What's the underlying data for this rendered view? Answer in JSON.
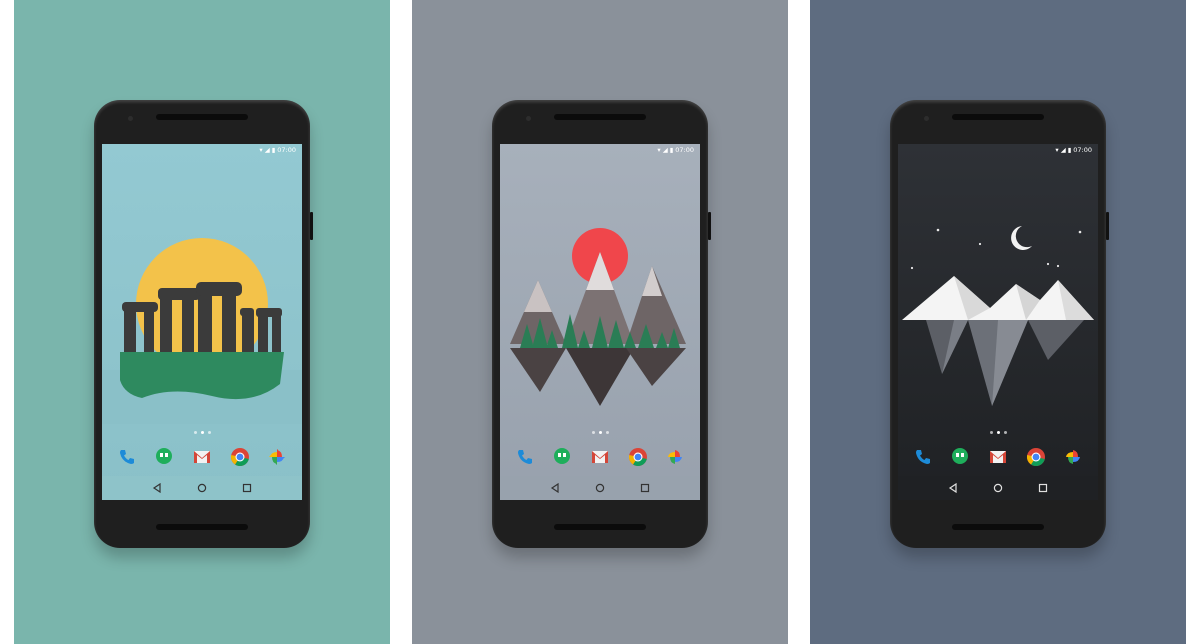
{
  "panels": [
    {
      "name": "stonehenge",
      "background": "#7ab5ac",
      "screen_top": "#93c9d2",
      "screen_bottom": "#8ac0c8",
      "nav_bg": "#8ec3c9"
    },
    {
      "name": "mountains",
      "background": "#8a919a",
      "screen_top": "#a7b0bb",
      "screen_bottom": "#98a1ad",
      "nav_bg": "#98a2ad"
    },
    {
      "name": "iceberg",
      "background": "#5e6c80",
      "screen_top": "#2e3136",
      "screen_bottom": "#1f2124",
      "nav_bg": "#1f2124"
    }
  ],
  "status_bar": {
    "time": "07:00"
  },
  "home_dots": {
    "count": 3,
    "active_index": 1
  },
  "dock_icons": [
    "phone-icon",
    "hangouts-icon",
    "gmail-icon",
    "chrome-icon",
    "photos-icon"
  ],
  "nav_buttons": [
    "back-icon",
    "home-icon",
    "recents-icon"
  ],
  "colors": {
    "phone_body": "#1f1f1f",
    "sun": "#f3c24a",
    "red_sun": "#f0464b",
    "grass": "#2e8a5f",
    "trees": "#2a7d55",
    "snow": "#f4f4f4",
    "phone_blue": "#1d8bd8",
    "hangouts_green": "#1eae5b",
    "gmail_red": "#d44638"
  }
}
